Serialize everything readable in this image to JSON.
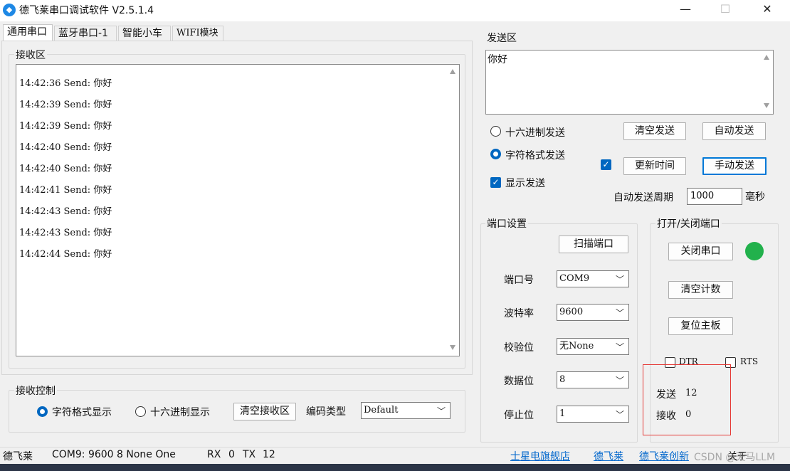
{
  "window": {
    "title": "德飞莱串口调试软件 V2.5.1.4",
    "minimize": "—",
    "maximize": "☐",
    "close": "✕"
  },
  "tabs": [
    "通用串口",
    "蓝牙串口-1",
    "智能小车",
    "WIFI模块"
  ],
  "receive": {
    "group_label": "接收区",
    "lines": [
      "14:42:36 Send: 你好",
      "14:42:39 Send: 你好",
      "14:42:39 Send: 你好",
      "14:42:40 Send: 你好",
      "14:42:40 Send: 你好",
      "14:42:41 Send: 你好",
      "14:42:43 Send: 你好",
      "14:42:43 Send: 你好",
      "14:42:44 Send: 你好"
    ]
  },
  "receive_control": {
    "group_label": "接收控制",
    "radio_text": "字符格式显示",
    "radio_hex": "十六进制显示",
    "clear_button": "清空接收区",
    "encoding_label": "编码类型",
    "encoding_value": "Default"
  },
  "send": {
    "group_label": "发送区",
    "text": "你好",
    "radio_hex": "十六进制发送",
    "radio_text": "字符格式发送",
    "show_send": "显示发送",
    "clear_button": "清空发送",
    "auto_button": "自动发送",
    "update_time_button": "更新时间",
    "manual_button": "手动发送",
    "period_label": "自动发送周期",
    "period_value": "1000",
    "period_unit": "毫秒"
  },
  "port_settings": {
    "group_label": "端口设置",
    "scan_button": "扫描端口",
    "port_label": "端口号",
    "port_value": "COM9",
    "baud_label": "波特率",
    "baud_value": "9600",
    "parity_label": "校验位",
    "parity_value": "无None",
    "databits_label": "数据位",
    "databits_value": "8",
    "stopbits_label": "停止位",
    "stopbits_value": "1"
  },
  "open_close": {
    "group_label": "打开/关闭端口",
    "close_button": "关闭串口",
    "clear_count_button": "清空计数",
    "reset_board_button": "复位主板",
    "dtr_label": "DTR",
    "rts_label": "RTS",
    "sent_label": "发送",
    "sent_value": "12",
    "recv_label": "接收",
    "recv_value": "0",
    "led_color": "#22b14c"
  },
  "statusbar": {
    "brand": "德飞莱",
    "port_info": "COM9: 9600 8 None One",
    "rx_label": "RX",
    "rx_value": "0",
    "tx_label": "TX",
    "tx_value": "12",
    "links": [
      "士星电旗舰店",
      "德飞莱",
      "德飞莱创新"
    ],
    "about": "关于",
    "watermark": "CSDN @天马LLM"
  }
}
